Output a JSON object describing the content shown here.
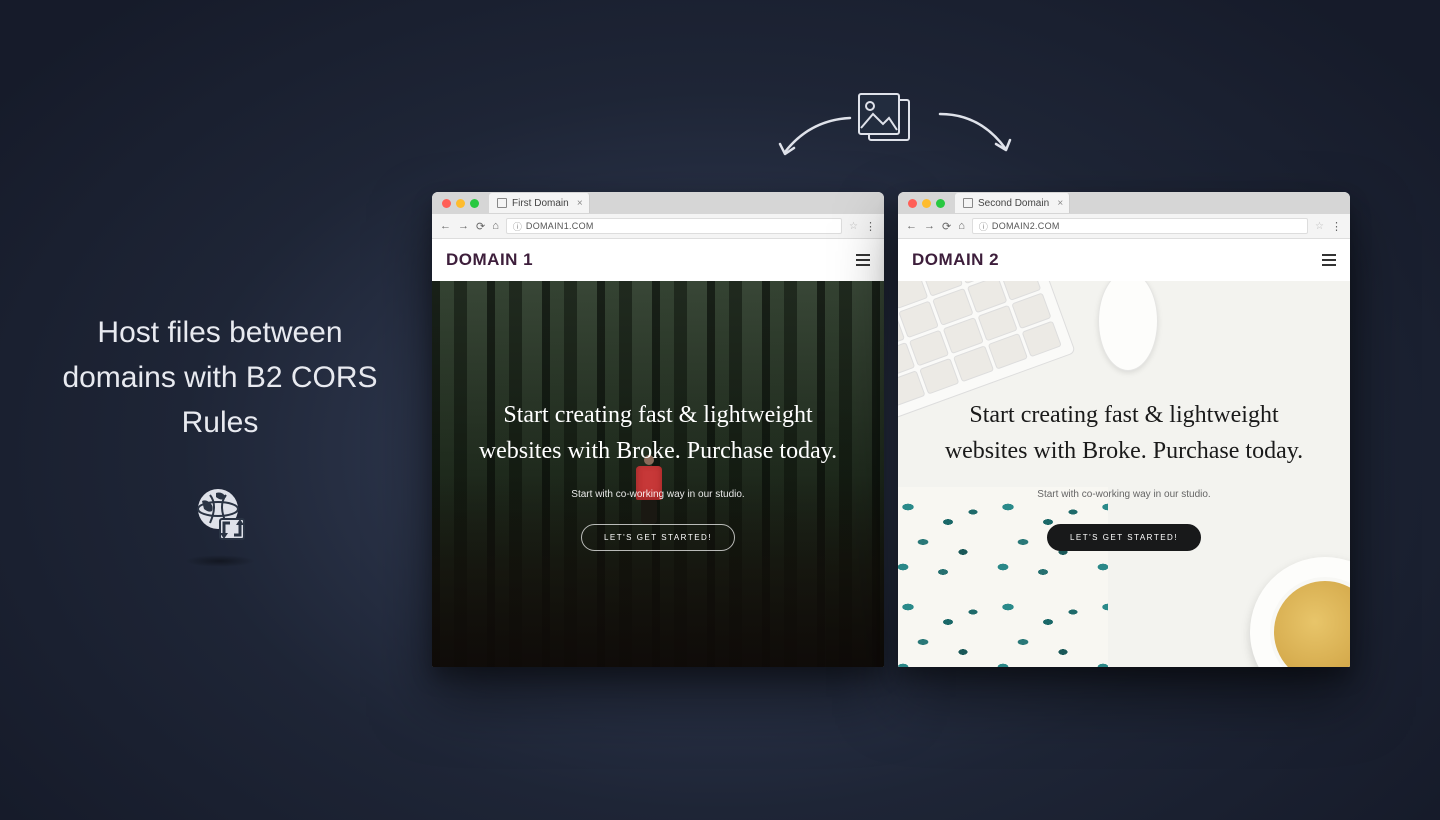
{
  "caption": "Host files between domains with B2 CORS Rules",
  "browsers": [
    {
      "tab_title": "First Domain",
      "url": "DOMAIN1.COM",
      "site_title": "DOMAIN 1",
      "hero_title": "Start creating fast & lightweight websites with Broke. Purchase today.",
      "hero_sub": "Start with co-working way in our studio.",
      "cta": "LET'S GET STARTED!"
    },
    {
      "tab_title": "Second Domain",
      "url": "DOMAIN2.COM",
      "site_title": "DOMAIN 2",
      "hero_title": "Start creating fast & lightweight websites with Broke. Purchase today.",
      "hero_sub": "Start with co-working way in our studio.",
      "cta": "LET'S GET STARTED!"
    }
  ],
  "icons": {
    "globe": "globe-with-arrows",
    "picture_stack": "image-stack",
    "arrow_left": "curved-arrow-left",
    "arrow_right": "curved-arrow-right"
  }
}
